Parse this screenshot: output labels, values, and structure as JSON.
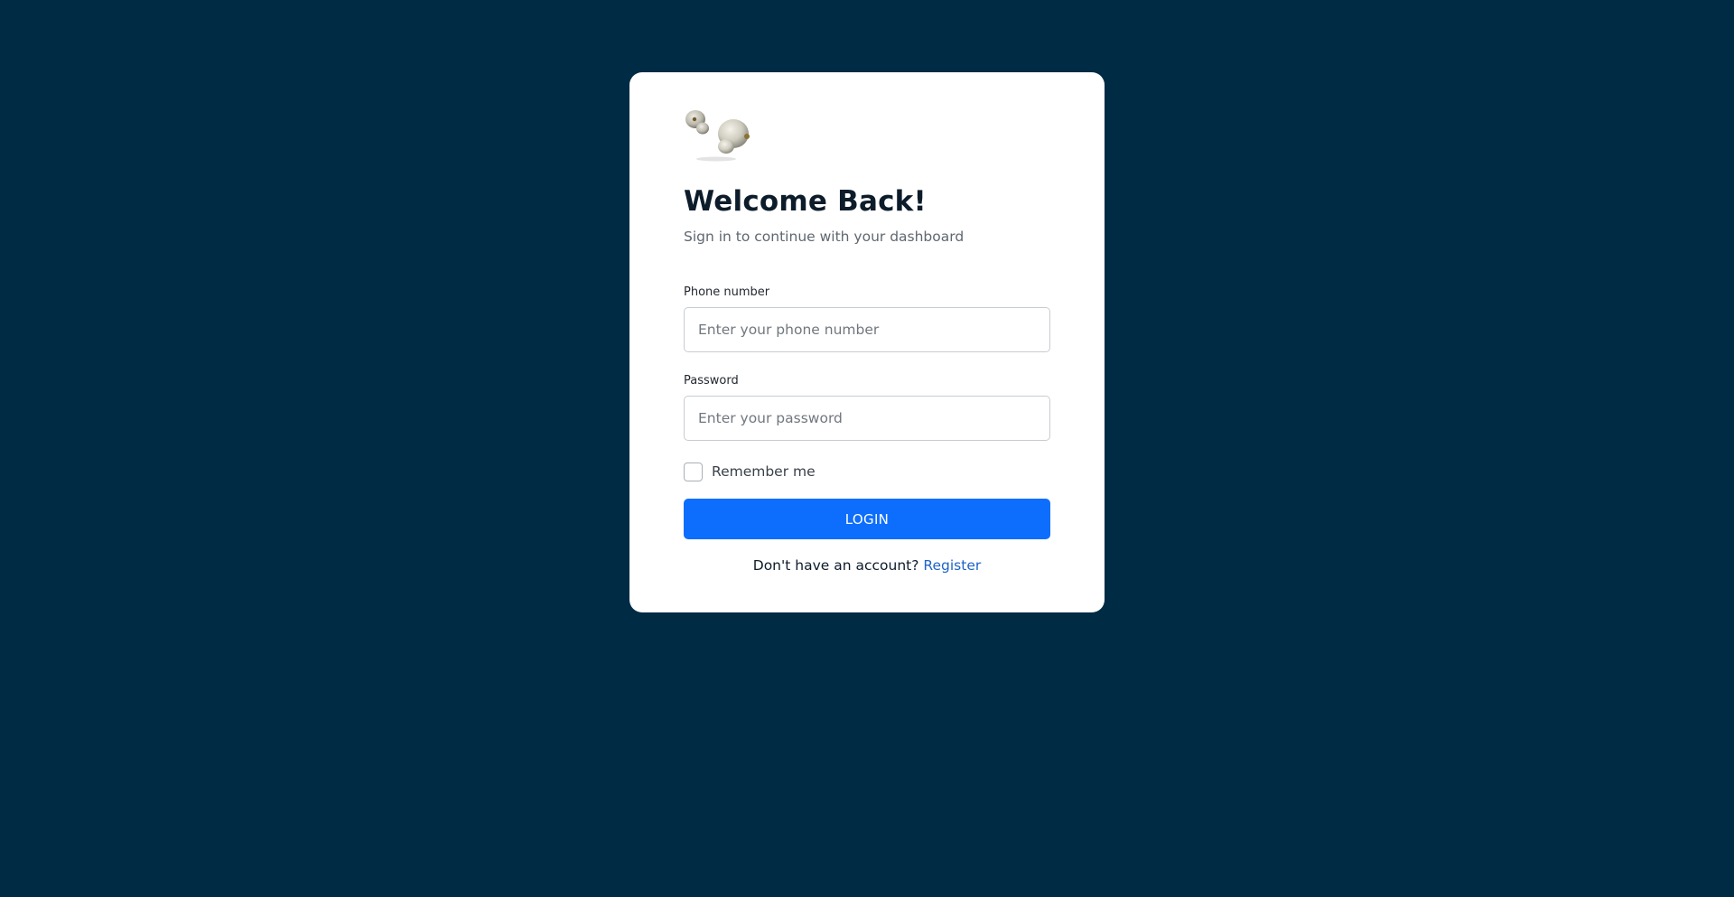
{
  "card": {
    "logo_icon": "earbuds-logo-icon",
    "title": "Welcome Back!",
    "subtitle": "Sign in to continue with your dashboard"
  },
  "form": {
    "phone": {
      "label": "Phone number",
      "placeholder": "Enter your phone number",
      "value": ""
    },
    "password": {
      "label": "Password",
      "placeholder": "Enter your password",
      "value": ""
    },
    "remember": {
      "label": "Remember me",
      "checked": false
    },
    "login_label": "LOGIN"
  },
  "footer": {
    "prompt": "Don't have an account?",
    "register_label": "Register"
  },
  "colors": {
    "background": "#002b44",
    "card": "#ffffff",
    "primary": "#0d6efd",
    "link": "#1f63c9"
  }
}
